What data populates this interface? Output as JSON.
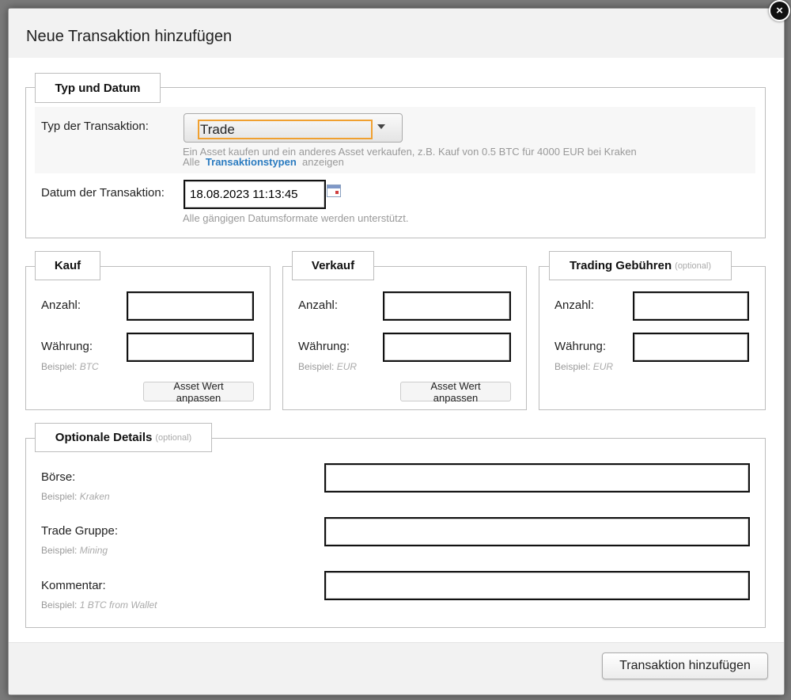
{
  "dialog": {
    "title": "Neue Transaktion hinzufügen",
    "close_glyph": "×",
    "submit_label": "Transaktion hinzufügen"
  },
  "type_date": {
    "legend": "Typ und Datum",
    "type_label": "Typ der Transaktion:",
    "type_value": "Trade",
    "type_desc": "Ein Asset kaufen und ein anderes Asset verkaufen, z.B. Kauf von 0.5 BTC für 4000 EUR bei Kraken",
    "all_prefix": "Alle",
    "all_link": "Transaktionstypen",
    "all_suffix": "anzeigen",
    "date_label": "Datum der Transaktion:",
    "date_value": "18.08.2023 11:13:45",
    "date_hint": "Alle gängigen Datumsformate werden unterstützt."
  },
  "kauf": {
    "legend": "Kauf",
    "amount_label": "Anzahl:",
    "currency_label": "Währung:",
    "example_prefix": "Beispiel:",
    "example_value": "BTC",
    "adjust_label": "Asset Wert anpassen"
  },
  "verkauf": {
    "legend": "Verkauf",
    "amount_label": "Anzahl:",
    "currency_label": "Währung:",
    "example_prefix": "Beispiel:",
    "example_value": "EUR",
    "adjust_label": "Asset Wert anpassen"
  },
  "fees": {
    "legend": "Trading Gebühren",
    "legend_optional": "(optional)",
    "amount_label": "Anzahl:",
    "currency_label": "Währung:",
    "example_prefix": "Beispiel:",
    "example_value": "EUR"
  },
  "optional": {
    "legend": "Optionale Details",
    "legend_optional": "(optional)",
    "boerse_label": "Börse:",
    "boerse_example_prefix": "Beispiel:",
    "boerse_example": "Kraken",
    "group_label": "Trade Gruppe:",
    "group_example_prefix": "Beispiel:",
    "group_example": "Mining",
    "comment_label": "Kommentar:",
    "comment_example_prefix": "Beispiel:",
    "comment_example": "1 BTC from Wallet"
  },
  "icons": {
    "close": "close-icon",
    "dropdown": "chevron-down-icon",
    "calendar": "calendar-icon"
  },
  "colors": {
    "focus_outline": "#f0a030",
    "link": "#2a7bc0"
  }
}
